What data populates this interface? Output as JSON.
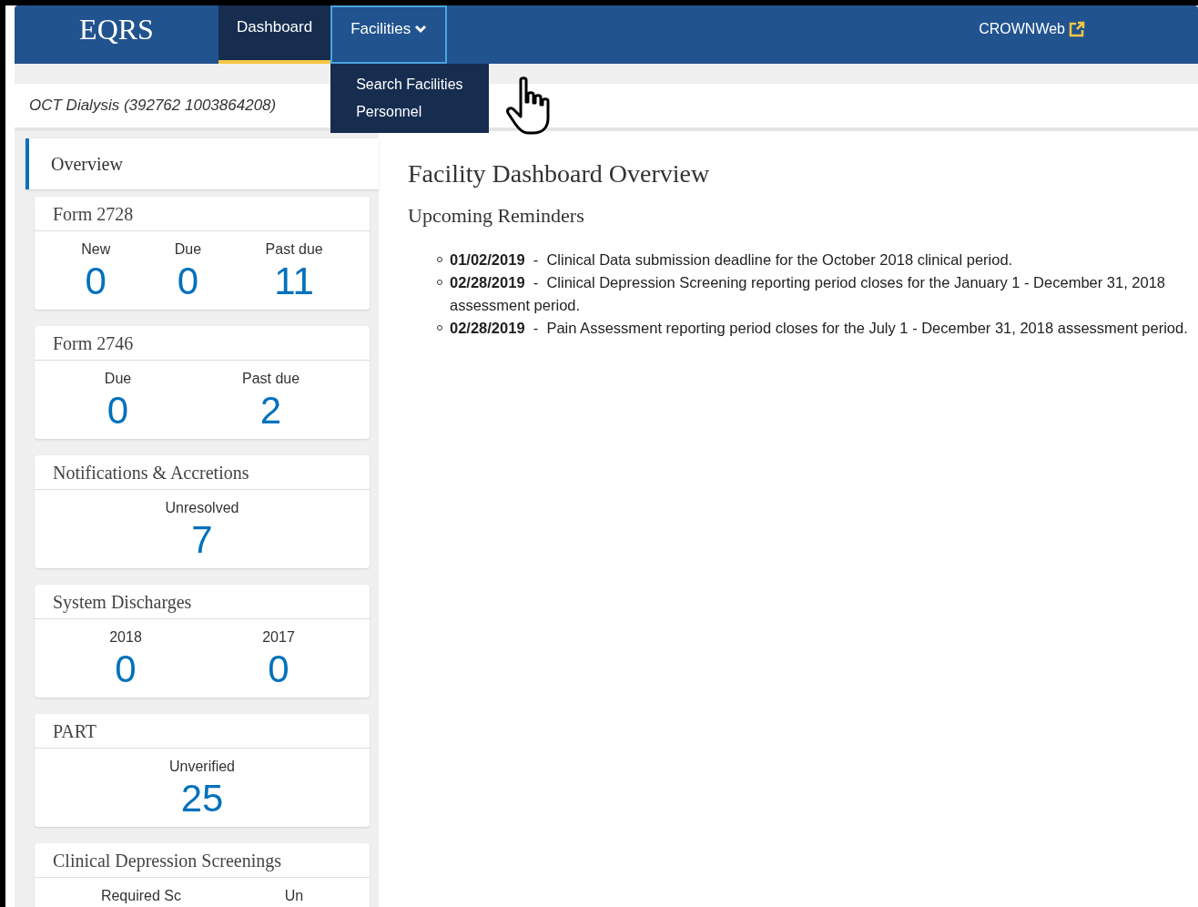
{
  "header": {
    "logo": "EQRS",
    "nav": [
      {
        "label": "Dashboard",
        "selected": true,
        "kind": "link"
      },
      {
        "label": "Facilities",
        "selected": false,
        "kind": "dropdown",
        "expanded": true,
        "menu": [
          "Search Facilities",
          "Personnel"
        ]
      }
    ],
    "external_link": "CROWNWeb"
  },
  "facility": "OCT Dialysis (392762 1003864208)",
  "sidebar": {
    "overview": {
      "label": "Overview",
      "selected": true
    },
    "cards": [
      {
        "title": "Form 2728",
        "stats": [
          {
            "label": "New",
            "value": "0"
          },
          {
            "label": "Due",
            "value": "0"
          },
          {
            "label": "Past due",
            "value": "11"
          }
        ]
      },
      {
        "title": "Form 2746",
        "stats": [
          {
            "label": "Due",
            "value": "0"
          },
          {
            "label": "Past due",
            "value": "2"
          }
        ]
      },
      {
        "title": "Notifications & Accretions",
        "stats": [
          {
            "label": "Unresolved",
            "value": "7"
          }
        ]
      },
      {
        "title": "System Discharges",
        "stats": [
          {
            "label": "2018",
            "value": "0"
          },
          {
            "label": "2017",
            "value": "0"
          }
        ]
      },
      {
        "title": "PART",
        "stats": [
          {
            "label": "Unverified",
            "value": "25"
          }
        ]
      },
      {
        "title": "Clinical Depression Screenings",
        "stats": [
          {
            "label": "Required Sc"
          },
          {
            "label": "Un"
          }
        ]
      }
    ]
  },
  "main": {
    "title": "Facility Dashboard Overview",
    "subtitle": "Upcoming Reminders",
    "reminders": [
      "**01/02/2019**  -  Clinical Data submission deadline for the October 2018 clinical period.",
      "**02/28/2019**  -  Clinical Depression Screening reporting period closes for the January 1 - December 31, 2018 assessment period.",
      "**02/28/2019**  -  Pain Assessment reporting period closes for the July 1 - December 31, 2018 assessment period."
    ]
  }
}
